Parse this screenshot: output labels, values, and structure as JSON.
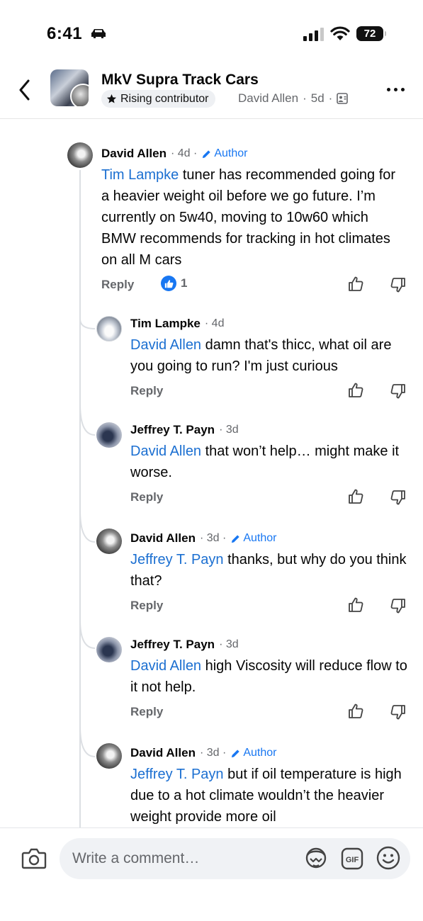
{
  "status_bar": {
    "time": "6:41",
    "battery": "72"
  },
  "header": {
    "group_name": "MkV Supra Track Cars",
    "badge": "Rising contributor",
    "poster": "David Allen",
    "age": "5d"
  },
  "comments": [
    {
      "author": "David Allen",
      "time": "4d",
      "author_tag": "Author",
      "mention": "Tim Lampke",
      "text": " tuner has recommended going for a heavier weight oil before we go future. I’m currently on 5w40, moving to 10w60 which BMW recommends for tracking in hot climates on all M cars",
      "reply": "Reply",
      "likes": "1"
    },
    {
      "author": "Tim Lampke",
      "time": "4d",
      "mention": "David Allen",
      "text": " damn that's thicc, what oil are you going to run? I'm just curious",
      "reply": "Reply"
    },
    {
      "author": "Jeffrey T. Payn",
      "time": "3d",
      "mention": "David Allen",
      "text": " that won’t help… might make it worse.",
      "reply": "Reply"
    },
    {
      "author": "David Allen",
      "time": "3d",
      "author_tag": "Author",
      "mention": "Jeffrey T. Payn",
      "text": " thanks, but why do you think that?",
      "reply": "Reply"
    },
    {
      "author": "Jeffrey T. Payn",
      "time": "3d",
      "mention": "David Allen",
      "text": " high Viscosity will reduce flow to it not help.",
      "reply": "Reply"
    },
    {
      "author": "David Allen",
      "time": "3d",
      "author_tag": "Author",
      "mention": "Jeffrey T. Payn",
      "text": " but if oil temperature is high due to a hot climate wouldn’t the heavier weight provide more oil"
    }
  ],
  "composer": {
    "placeholder": "Write a comment…"
  },
  "colors": {
    "link": "#1b6fd1",
    "accent": "#1877f2",
    "muted": "#65676b"
  }
}
